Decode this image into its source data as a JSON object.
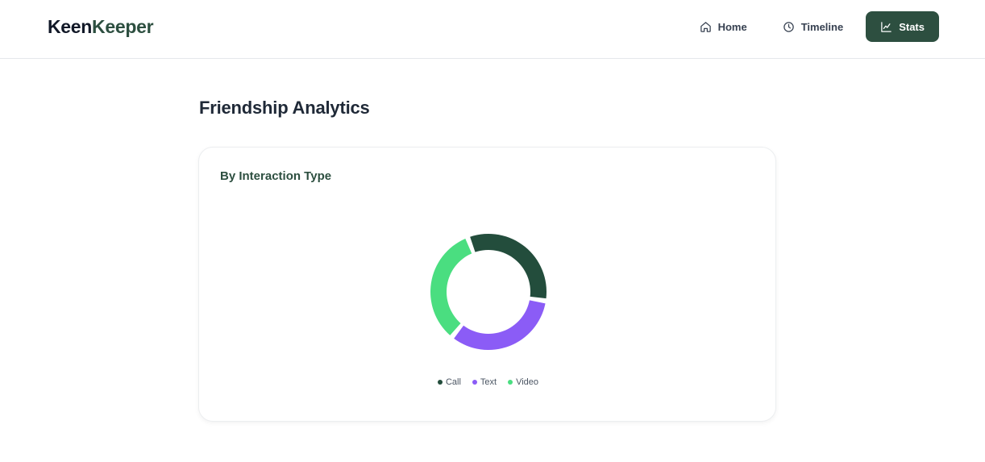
{
  "brand": {
    "part1": "Keen",
    "part2": "Keeper"
  },
  "nav": {
    "items": [
      {
        "label": "Home",
        "icon": "home-icon"
      },
      {
        "label": "Timeline",
        "icon": "clock-icon"
      },
      {
        "label": "Stats",
        "icon": "chart-line-icon",
        "active": true
      }
    ]
  },
  "page": {
    "title": "Friendship Analytics"
  },
  "card": {
    "title": "By Interaction Type"
  },
  "colors": {
    "accent": "#2d4f40",
    "call": "#234d3c",
    "text": "#8b5cf6",
    "video": "#4ade80"
  },
  "chart_data": {
    "type": "pie",
    "categories": [
      "Call",
      "Text",
      "Video"
    ],
    "values": [
      33.3,
      33.3,
      33.3
    ],
    "title": "By Interaction Type",
    "legend": "bottom"
  }
}
